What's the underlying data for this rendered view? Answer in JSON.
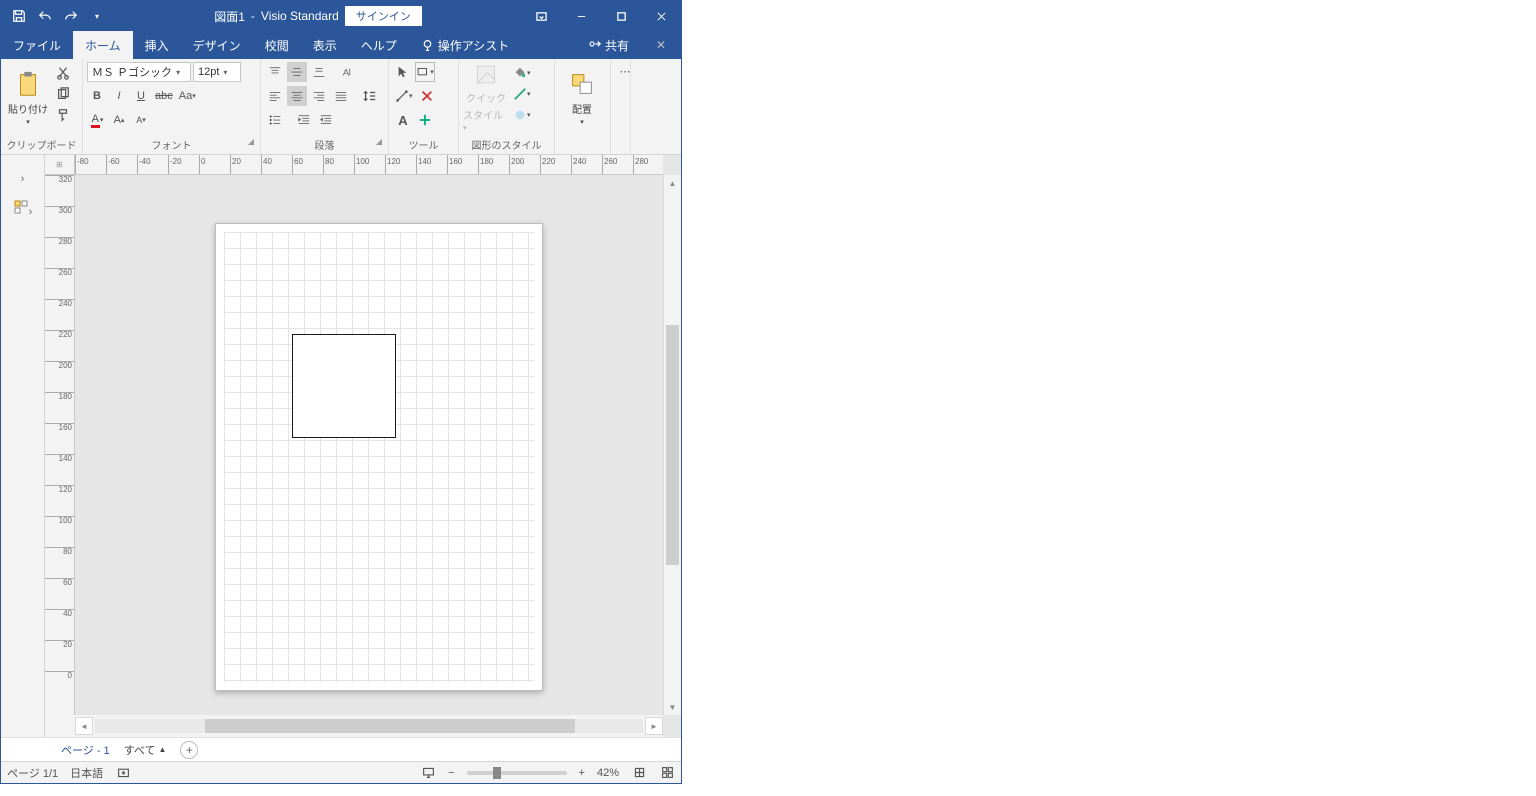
{
  "title": {
    "doc": "図面1",
    "sep": "-",
    "app": "Visio Standard",
    "signin": "サインイン"
  },
  "tabs": {
    "file": "ファイル",
    "home": "ホーム",
    "insert": "挿入",
    "design": "デザイン",
    "review": "校閲",
    "view": "表示",
    "help": "ヘルプ",
    "tell": "操作アシスト",
    "share": "共有"
  },
  "ribbon": {
    "clipboard": {
      "paste": "貼り付け",
      "label": "クリップボード"
    },
    "font": {
      "name": "ＭＳ Ｐゴシック",
      "size": "12pt",
      "label": "フォント"
    },
    "paragraph": {
      "label": "段落"
    },
    "tools": {
      "label": "ツール"
    },
    "shapestyles": {
      "quick": "クイック",
      "style": "スタイル",
      "label": "図形のスタイル"
    },
    "arrange": {
      "label": "配置"
    }
  },
  "hruler": [
    "-80",
    "-60",
    "-40",
    "-20",
    "0",
    "20",
    "40",
    "60",
    "80",
    "100",
    "120",
    "140",
    "160",
    "180",
    "200",
    "220",
    "240",
    "260",
    "280"
  ],
  "vruler": [
    "320",
    "300",
    "280",
    "260",
    "240",
    "220",
    "200",
    "180",
    "160",
    "140",
    "120",
    "100",
    "80",
    "60",
    "40",
    "20",
    "0"
  ],
  "pagetabs": {
    "page": "ページ - 1",
    "all": "すべて",
    "arrow": "▲"
  },
  "status": {
    "page": "ページ 1/1",
    "lang": "日本語",
    "zoom": "42%",
    "minus": "−",
    "plus": "+"
  }
}
